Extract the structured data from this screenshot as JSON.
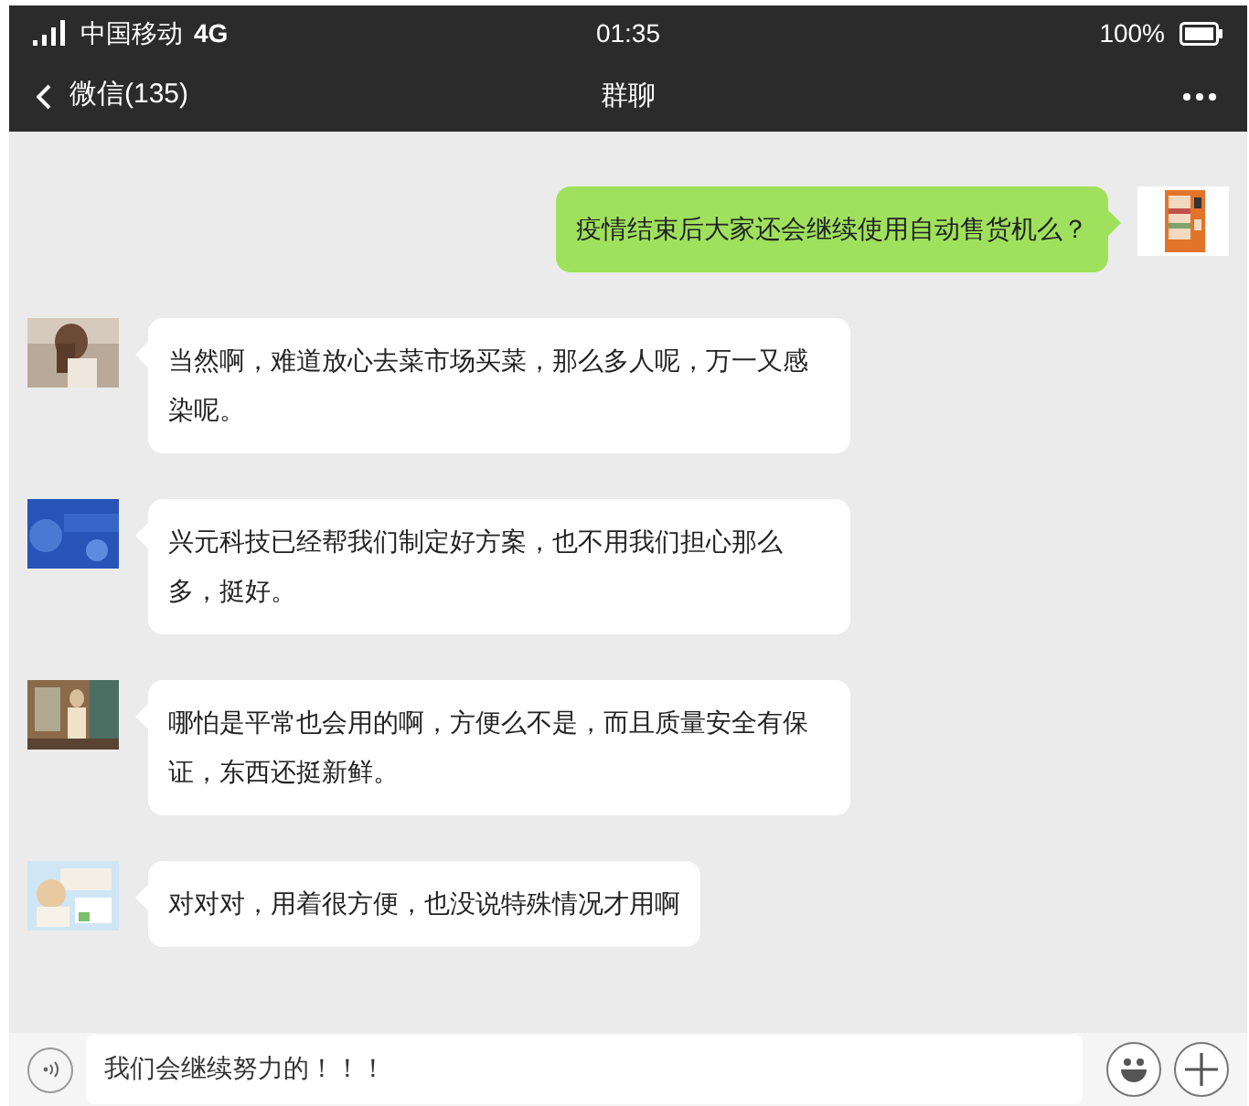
{
  "status_bar": {
    "carrier": "中国移动",
    "network": "4G",
    "time": "01:35",
    "battery": "100%"
  },
  "nav": {
    "back": "微信(135)",
    "title": "群聊"
  },
  "messages": [
    {
      "kind": "outgoing",
      "text": "疫情结束后大家还会继续使用自动售货机么？"
    },
    {
      "kind": "incoming",
      "text": "当然啊，难道放心去菜市场买菜，那么多人呢，万一又感染呢。"
    },
    {
      "kind": "incoming",
      "text": "兴元科技已经帮我们制定好方案，也不用我们担心那么多，挺好。"
    },
    {
      "kind": "incoming",
      "text": "哪怕是平常也会用的啊，方便么不是，而且质量安全有保证，东西还挺新鲜。"
    },
    {
      "kind": "incoming",
      "text": "对对对，用着很方便，也没说特殊情况才用啊"
    }
  ],
  "input": {
    "value": "我们会继续努力的！！！"
  }
}
